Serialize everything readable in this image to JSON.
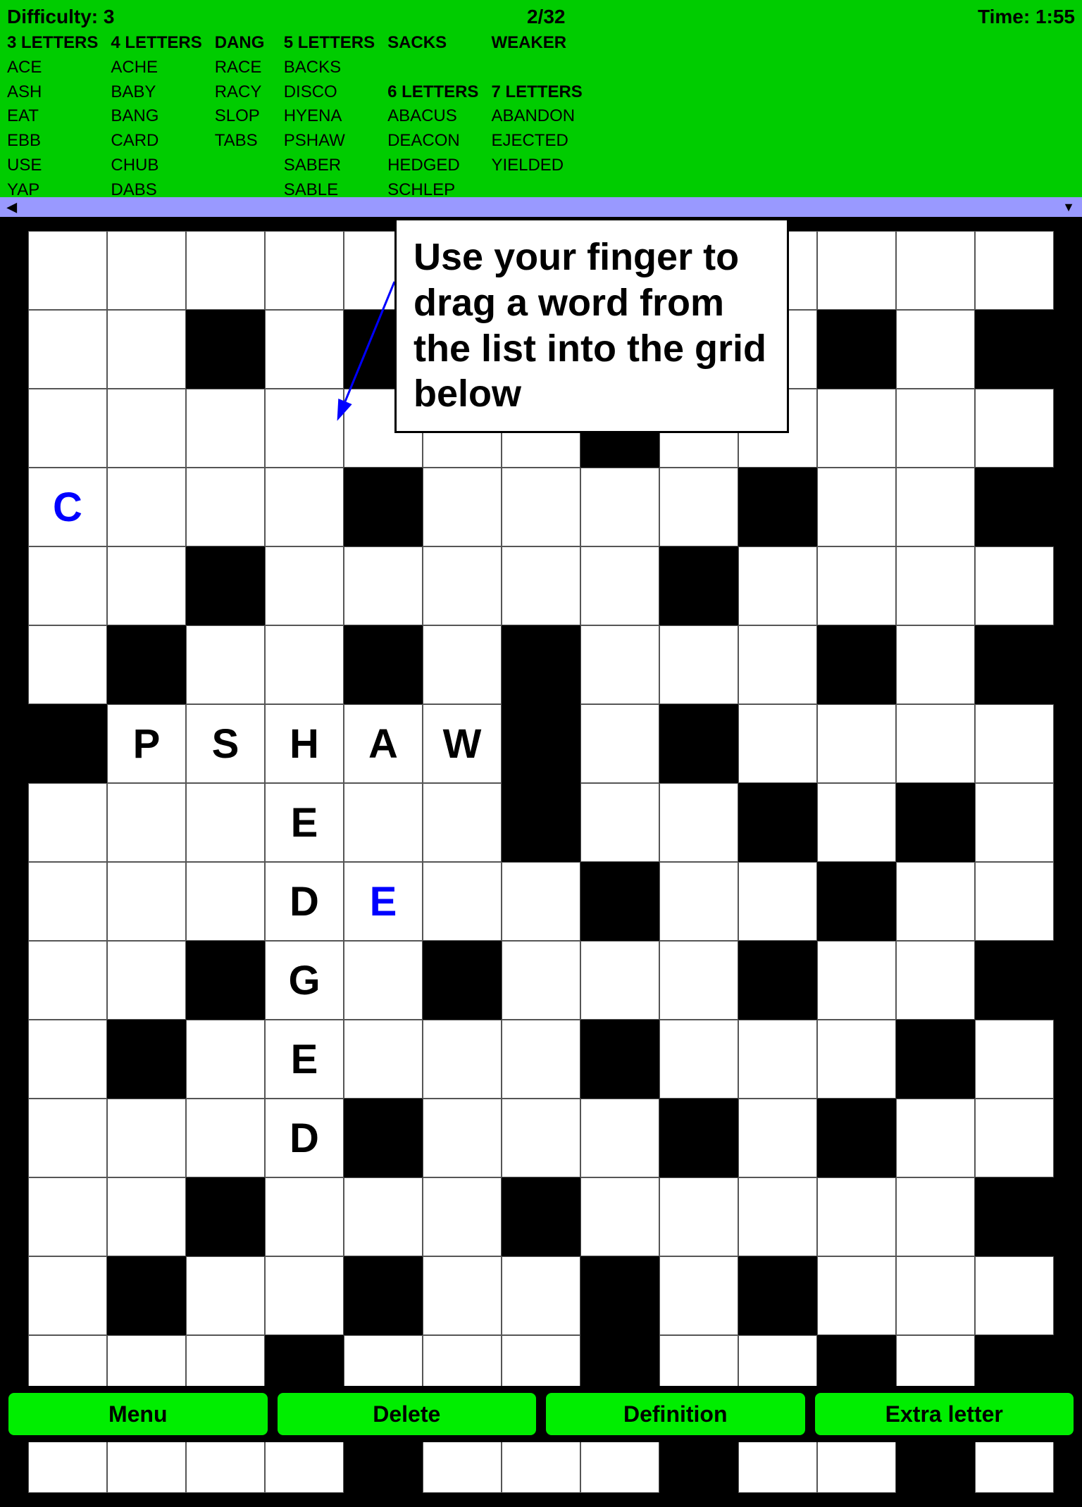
{
  "header": {
    "difficulty_label": "Difficulty: 3",
    "page_indicator": "2/32",
    "time_label": "Time: 1:55"
  },
  "word_columns": [
    {
      "header": "3 LETTERS",
      "words": [
        "ACE",
        "ASH",
        "EAT",
        "EBB",
        "USE",
        "YAP"
      ]
    },
    {
      "header": "4 LETTERS",
      "words": [
        "ACHE",
        "BABY",
        "BANG",
        "CARD",
        "CHUB",
        "DABS"
      ]
    },
    {
      "header": "DANG",
      "words": [
        "RACE",
        "RACY",
        "SLOP",
        "TABS"
      ]
    },
    {
      "header": "5 LETTERS",
      "words": [
        "BACKS",
        "DISCO",
        "HYENA",
        "PSHAW",
        "SABER",
        "SABLE"
      ]
    },
    {
      "header": "SACKS",
      "words": [
        "",
        "6 LETTERS",
        "ABACUS",
        "DEACON",
        "HEDGED",
        "SCHLEP"
      ]
    },
    {
      "header": "WEAKER",
      "words": [
        "",
        "7 LETTERS",
        "ABANDON",
        "EJECTED",
        "YIELDED"
      ]
    }
  ],
  "tooltip": {
    "text": "Use your finger to drag a word from the list into the grid below"
  },
  "grid": {
    "rows": 16,
    "cols": 13,
    "cells": [
      "W",
      "W",
      "W",
      "W",
      "W",
      "B",
      "W",
      "W",
      "W",
      "W",
      "W",
      "W",
      "W",
      "W",
      "W",
      "B",
      "W",
      "B",
      "W",
      "B",
      "W",
      "B",
      "W",
      "B",
      "W",
      "B",
      "W",
      "W",
      "W",
      "W",
      "W",
      "W",
      "W",
      "B",
      "W",
      "W",
      "W",
      "W",
      "W",
      "CL",
      "W",
      "W",
      "W",
      "B",
      "W",
      "W",
      "W",
      "W",
      "B",
      "W",
      "W",
      "B",
      "W",
      "W",
      "B",
      "W",
      "W",
      "W",
      "W",
      "W",
      "B",
      "W",
      "W",
      "W",
      "W",
      "W",
      "B",
      "W",
      "W",
      "B",
      "W",
      "B",
      "W",
      "W",
      "W",
      "B",
      "W",
      "B",
      "B",
      "P",
      "S",
      "H",
      "A",
      "W",
      "B",
      "W",
      "B",
      "W",
      "W",
      "W",
      "W",
      "W",
      "W",
      "W",
      "E",
      "W",
      "W",
      "B",
      "W",
      "W",
      "B",
      "W",
      "B",
      "W",
      "W",
      "W",
      "W",
      "D",
      "EL",
      "W",
      "W",
      "B",
      "W",
      "W",
      "B",
      "W",
      "W",
      "W",
      "W",
      "B",
      "G",
      "W",
      "B",
      "W",
      "W",
      "W",
      "B",
      "W",
      "W",
      "B",
      "W",
      "B",
      "W",
      "E",
      "W",
      "W",
      "W",
      "B",
      "W",
      "W",
      "W",
      "B",
      "W",
      "W",
      "W",
      "W",
      "D",
      "B",
      "W",
      "W",
      "W",
      "B",
      "W",
      "B",
      "W",
      "W",
      "W",
      "W",
      "B",
      "W",
      "W",
      "W",
      "B",
      "W",
      "W",
      "W",
      "W",
      "W",
      "B",
      "W",
      "B",
      "W",
      "W",
      "B",
      "W",
      "W",
      "B",
      "W",
      "B",
      "W",
      "W",
      "W",
      "W",
      "W",
      "W",
      "B",
      "W",
      "W",
      "W",
      "B",
      "W",
      "W",
      "B",
      "W",
      "B",
      "W",
      "W",
      "W",
      "W",
      "B",
      "W",
      "W",
      "W",
      "B",
      "W",
      "W",
      "B",
      "W"
    ]
  },
  "buttons": {
    "menu": "Menu",
    "delete": "Delete",
    "definition": "Definition",
    "extra_letter": "Extra letter"
  }
}
